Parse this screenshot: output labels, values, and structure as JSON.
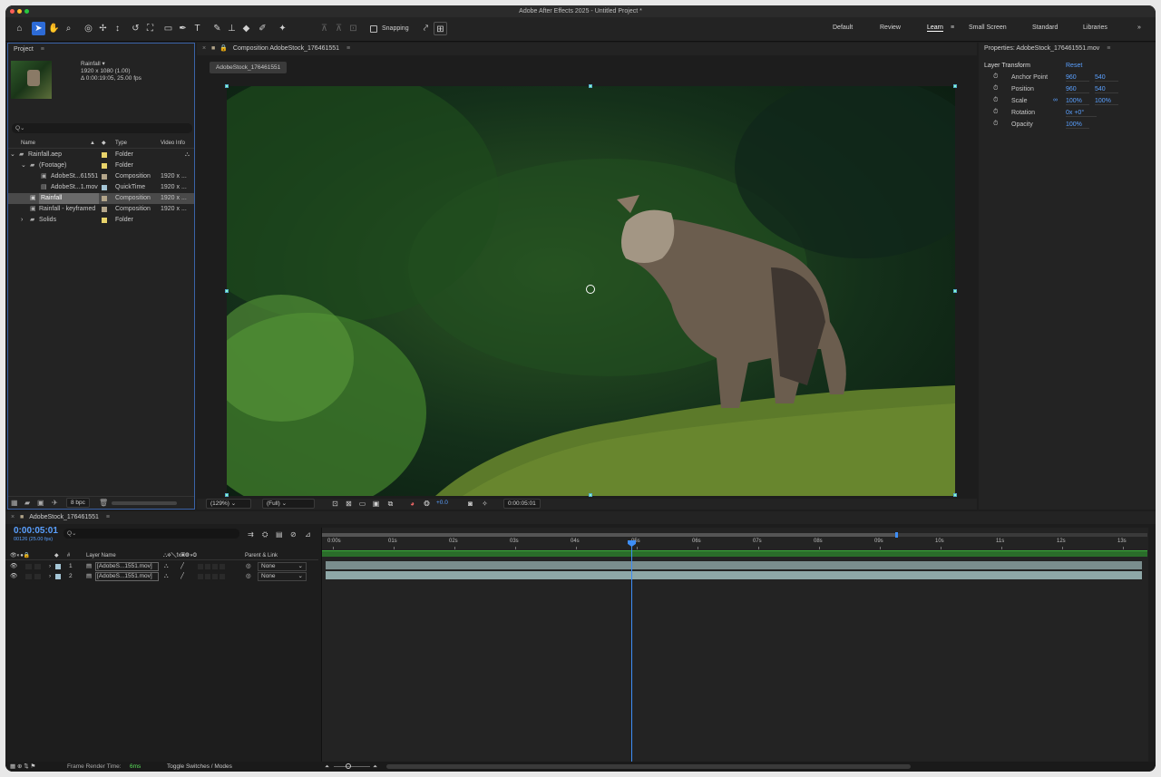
{
  "window": {
    "title": "Adobe After Effects 2025 - Untitled Project *"
  },
  "toolbar": {
    "snapping_label": "Snapping",
    "workspaces": [
      "Default",
      "Review",
      "Learn",
      "Small Screen",
      "Standard",
      "Libraries"
    ],
    "active_workspace": "Learn",
    "more": "»"
  },
  "project": {
    "title": "Project",
    "thumb_name": "Rainfall ▾",
    "thumb_info1": "1920 x 1080 (1.00)",
    "thumb_info2": "Δ 0:00:19:05, 25.00 fps",
    "search_placeholder": "Q⌄",
    "columns": {
      "name": "Name",
      "type": "Type",
      "video": "Video Info"
    },
    "items": [
      {
        "name": "Rainfall.aep",
        "type": "Folder",
        "info": "",
        "color": "#e8d36a"
      },
      {
        "name": "(Footage)",
        "type": "Folder",
        "info": "",
        "color": "#e8d36a"
      },
      {
        "name": "AdobeSt...61551",
        "type": "Composition",
        "info": "1920 x ...",
        "color": "#b3a58a"
      },
      {
        "name": "AdobeSt...1.mov",
        "type": "QuickTime",
        "info": "1920 x ...",
        "color": "#a5c6d6"
      },
      {
        "name": "Rainfall",
        "type": "Composition",
        "info": "1920 x ...",
        "color": "#b3a58a"
      },
      {
        "name": "Rainfall - keyframed",
        "type": "Composition",
        "info": "1920 x ...",
        "color": "#b3a58a"
      },
      {
        "name": "Solids",
        "type": "Folder",
        "info": "",
        "color": "#e8d36a"
      }
    ],
    "bpc": "8 bpc"
  },
  "composition": {
    "tab_label": "Composition AdobeStock_176461551",
    "breadcrumb": "AdobeStock_176461551",
    "zoom": "(129%)",
    "resolution": "(Full)",
    "exposure": "+0.0",
    "timecode": "0:00:05:01"
  },
  "properties": {
    "title": "Properties: AdobeStock_176461551.mov",
    "section": "Layer Transform",
    "reset": "Reset",
    "rows": [
      {
        "label": "Anchor Point",
        "v1": "960",
        "v2": "540"
      },
      {
        "label": "Position",
        "v1": "960",
        "v2": "540"
      },
      {
        "label": "Scale",
        "v1": "100%",
        "v2": "100%"
      },
      {
        "label": "Rotation",
        "v1": "0x +0°",
        "v2": ""
      },
      {
        "label": "Opacity",
        "v1": "100%",
        "v2": ""
      }
    ]
  },
  "timeline": {
    "tab_label": "AdobeStock_176461551",
    "timecode": "0:00:05:01",
    "frames": "00126 (25.00 fps)",
    "search_placeholder": "Q⌄",
    "layer_name_header": "Layer Name",
    "parent_header": "Parent & Link",
    "ruler": [
      "0:00s",
      "01s",
      "02s",
      "03s",
      "04s",
      "05s",
      "06s",
      "07s",
      "08s",
      "09s",
      "10s",
      "11s",
      "12s",
      "13s"
    ],
    "layers": [
      {
        "num": "1",
        "name": "[AdobeS...1551.mov]",
        "parent": "None"
      },
      {
        "num": "2",
        "name": "[AdobeS...1551.mov]",
        "parent": "None"
      }
    ],
    "render_label": "Frame Render Time:",
    "render_value": "6ms",
    "toggle_label": "Toggle Switches / Modes"
  },
  "colors": {
    "accent": "#2d6bd6",
    "link": "#5aa0ff",
    "playhead": "#3e8ef7"
  }
}
